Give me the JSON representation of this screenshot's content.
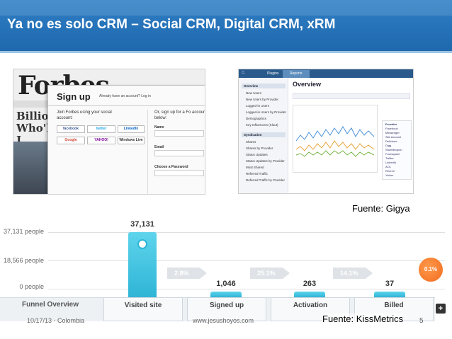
{
  "slide": {
    "title": "Ya no es solo CRM – Social CRM, Digital CRM, xRM",
    "fuente_gigya": "Fuente: Gigya",
    "fuente_kiss": "Fuente: KissMetrics",
    "footer_date": "10/17/13 - Colombia",
    "footer_site": "www.jesushoyos.com",
    "page_number": "5",
    "colors": {
      "title_bar": "#1f68ad",
      "funnel_bar": "#2fb5d6",
      "badge": "#f26b1d"
    }
  },
  "forbes": {
    "logo": "Forbes",
    "side_text": "Billionai Who'll J",
    "signup_title": "Sign up",
    "have_account": "Already have an account? Log in",
    "social_title": "Join Forbes using your social account:",
    "or_title": "Or, sign up for a Fo account below:",
    "social_buttons": [
      "facebook",
      "twitter",
      "LinkedIn",
      "Google",
      "YAHOO!",
      "Windows Live"
    ],
    "fields": [
      "Name",
      "Email",
      "Choose a Password"
    ]
  },
  "gigya": {
    "tabs": [
      "Plugins",
      "Reports"
    ],
    "overview": "Overview",
    "sidebar_sections": [
      "Overview",
      "Syndication"
    ],
    "sidebar_items_overview": [
      "New Users",
      "New Users by Provider",
      "Logged-in Users",
      "Logged-in Users by Provider",
      "Demographics",
      "Key Influencers (Klout)"
    ],
    "sidebar_items_syndication": [
      "Shares",
      "Shares by Provider",
      "Status Updates",
      "Status Updates by Provider",
      "Most Shared",
      "Referred Traffic",
      "Referred Traffic by Provider"
    ],
    "legend_items": [
      "Provider",
      "Facebook",
      "Messenger",
      "Site Account",
      "Delicious",
      "Digg",
      "Stumbleupon",
      "Foursquare",
      "Twitter",
      "LinkedIn",
      "AOL",
      "Renren",
      "Yahoo"
    ]
  },
  "funnel": {
    "y_labels": [
      "37,131 people",
      "18,566 people",
      "0 people"
    ],
    "steps": [
      {
        "name": "Visited site",
        "count": "37,131",
        "value": 37131
      },
      {
        "name": "Signed up",
        "count": "1,046",
        "value": 1046
      },
      {
        "name": "Activation",
        "count": "263",
        "value": 263
      },
      {
        "name": "Billed",
        "count": "37",
        "value": 37
      }
    ],
    "conversion_rates": [
      "2.8%",
      "25.1%",
      "14.1%"
    ],
    "overall_rate": "0.1%",
    "overview_label": "Funnel Overview",
    "add_label": "+"
  }
}
